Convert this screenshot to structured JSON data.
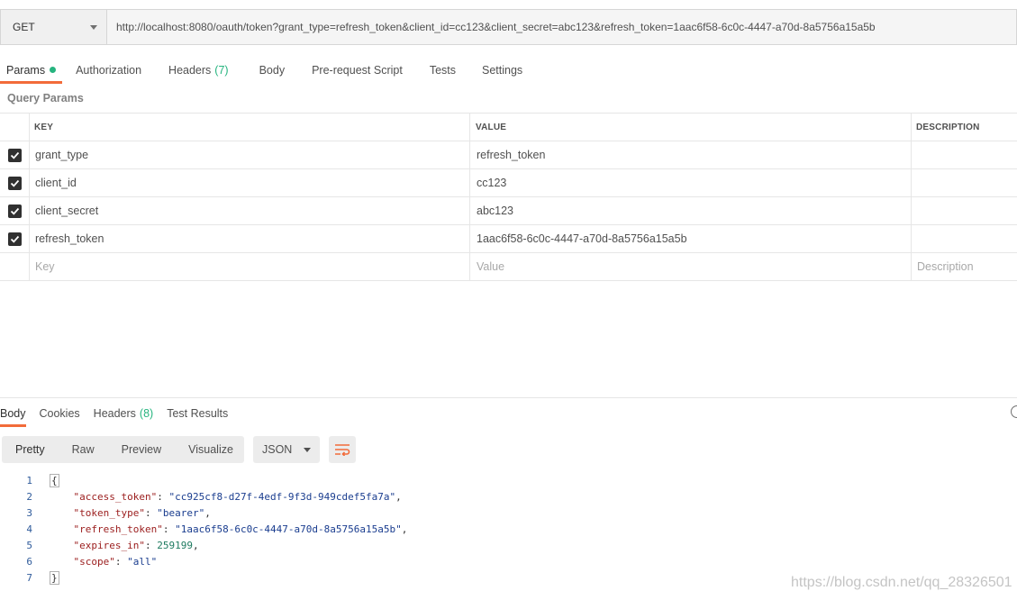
{
  "request": {
    "method": "GET",
    "url": "http://localhost:8080/oauth/token?grant_type=refresh_token&client_id=cc123&client_secret=abc123&refresh_token=1aac6f58-6c0c-4447-a70d-8a5756a15a5b"
  },
  "request_tabs": {
    "params": "Params",
    "authorization": "Authorization",
    "headers": "Headers",
    "headers_count": "(7)",
    "body": "Body",
    "prerequest": "Pre-request Script",
    "tests": "Tests",
    "settings": "Settings"
  },
  "query_params": {
    "title": "Query Params",
    "columns": {
      "key": "KEY",
      "value": "VALUE",
      "description": "DESCRIPTION"
    },
    "rows": [
      {
        "key": "grant_type",
        "value": "refresh_token",
        "checked": true
      },
      {
        "key": "client_id",
        "value": "cc123",
        "checked": true
      },
      {
        "key": "client_secret",
        "value": "abc123",
        "checked": true
      },
      {
        "key": "refresh_token",
        "value": "1aac6f58-6c0c-4447-a70d-8a5756a15a5b",
        "checked": true
      }
    ],
    "placeholders": {
      "key": "Key",
      "value": "Value",
      "description": "Description"
    }
  },
  "response_tabs": {
    "body": "Body",
    "cookies": "Cookies",
    "headers": "Headers",
    "headers_count": "(8)",
    "test_results": "Test Results"
  },
  "view_modes": {
    "pretty": "Pretty",
    "raw": "Raw",
    "preview": "Preview",
    "visualize": "Visualize"
  },
  "format": "JSON",
  "response_body": {
    "line_numbers": [
      "1",
      "2",
      "3",
      "4",
      "5",
      "6",
      "7"
    ],
    "open_brace": "{",
    "close_brace": "}",
    "fields": [
      {
        "key": "\"access_token\"",
        "value": "\"cc925cf8-d27f-4edf-9f3d-949cdef5fa7a\"",
        "comma": ","
      },
      {
        "key": "\"token_type\"",
        "value": "\"bearer\"",
        "comma": ","
      },
      {
        "key": "\"refresh_token\"",
        "value": "\"1aac6f58-6c0c-4447-a70d-8a5756a15a5b\"",
        "comma": ","
      },
      {
        "key": "\"expires_in\"",
        "value": "259199",
        "comma": ","
      },
      {
        "key": "\"scope\"",
        "value": "\"all\"",
        "comma": ""
      }
    ]
  },
  "watermark": "https://blog.csdn.net/qq_28326501",
  "colors": {
    "accent": "#f26b3a",
    "success": "#26b47f"
  }
}
